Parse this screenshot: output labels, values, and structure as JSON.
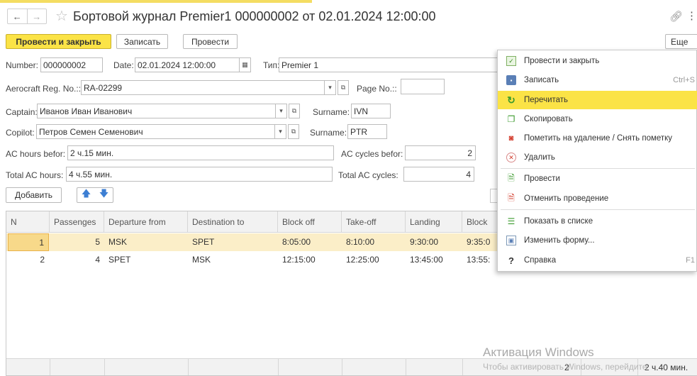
{
  "window": {
    "title": "Бортовой журнал Premier1 000000002 от 02.01.2024 12:00:00",
    "back": "←",
    "forward": "→"
  },
  "toolbar": {
    "post_close": "Провести и закрыть",
    "save": "Записать",
    "post": "Провести",
    "more": "Еще"
  },
  "form": {
    "number_label": "Number:",
    "number": "000000002",
    "date_label": "Date:",
    "date": "02.01.2024 12:00:00",
    "type_label": "Тип:",
    "type": "Premier 1",
    "reg_label": "Aerocraft Reg. No.::",
    "reg": "RA-02299",
    "page_label": "Page No.::",
    "page": "",
    "captain_label": "Captain:",
    "captain": "Иванов Иван Иванович",
    "cap_surname_label": "Surname:",
    "cap_surname": "IVN",
    "copilot_label": "Copilot:",
    "copilot": "Петров Семен Семенович",
    "co_surname_label": "Surname:",
    "co_surname": "PTR",
    "ac_hours_before_label": "AC hours befor:",
    "ac_hours_before": "2 ч.15 мин.",
    "ac_cycles_before_label": "AC cycles befor:",
    "ac_cycles_before": "2",
    "total_hours_label": "Total AC hours:",
    "total_hours": "4 ч.55 мин.",
    "total_cycles_label": "Total AC cycles:",
    "total_cycles": "4"
  },
  "table_toolbar": {
    "add": "Добавить"
  },
  "table": {
    "columns": [
      "N",
      "Passenges",
      "Departure from",
      "Destination to",
      "Block off",
      "Take-off",
      "Landing",
      "Block"
    ],
    "rows": [
      {
        "n": "1",
        "passengers": "5",
        "from": "MSK",
        "to": "SPET",
        "block_off": "8:05:00",
        "takeoff": "8:10:00",
        "landing": "9:30:00",
        "block_on": "9:35:0"
      },
      {
        "n": "2",
        "passengers": "4",
        "from": "SPET",
        "to": "MSK",
        "block_off": "12:15:00",
        "takeoff": "12:25:00",
        "landing": "13:45:00",
        "block_on": "13:55:"
      }
    ],
    "footer_count": "2",
    "footer_total": "2 ч.40 мин."
  },
  "menu": {
    "items": [
      {
        "label": "Провести и закрыть",
        "icon": "post-close-icon",
        "shortcut": ""
      },
      {
        "label": "Записать",
        "icon": "save-icon",
        "shortcut": "Ctrl+S"
      },
      {
        "label": "Перечитать",
        "icon": "refresh-icon",
        "shortcut": ""
      },
      {
        "label": "Скопировать",
        "icon": "copy-icon",
        "shortcut": ""
      },
      {
        "label": "Пометить на удаление / Снять пометку",
        "icon": "mark-delete-icon",
        "shortcut": ""
      },
      {
        "label": "Удалить",
        "icon": "delete-icon",
        "shortcut": ""
      },
      {
        "label": "Провести",
        "icon": "post-icon",
        "shortcut": ""
      },
      {
        "label": "Отменить проведение",
        "icon": "unpost-icon",
        "shortcut": ""
      },
      {
        "label": "Показать в списке",
        "icon": "show-in-list-icon",
        "shortcut": ""
      },
      {
        "label": "Изменить форму...",
        "icon": "change-form-icon",
        "shortcut": ""
      },
      {
        "label": "Справка",
        "icon": "help-icon",
        "shortcut": "F1"
      }
    ]
  },
  "watermark": {
    "line1": "Активация Windows",
    "line2": "Чтобы активировать Windows, перейдите"
  },
  "colors": {
    "accent": "#fbe346",
    "selected_row": "#fbeec8"
  }
}
